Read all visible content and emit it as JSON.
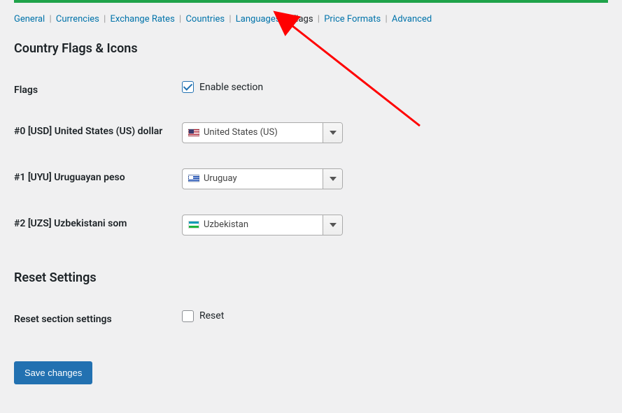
{
  "tabs": {
    "general": "General",
    "currencies": "Currencies",
    "exchange_rates": "Exchange Rates",
    "countries": "Countries",
    "languages": "Languages",
    "flags": "Flags",
    "price_formats": "Price Formats",
    "advanced": "Advanced"
  },
  "section_title": "Country Flags & Icons",
  "flags_row": {
    "label": "Flags",
    "enable_label": "Enable section",
    "checked": true
  },
  "currency_rows": [
    {
      "label": "#0 [USD] United States (US) dollar",
      "value": "United States (US)",
      "flag": "us"
    },
    {
      "label": "#1 [UYU] Uruguayan peso",
      "value": "Uruguay",
      "flag": "uy"
    },
    {
      "label": "#2 [UZS] Uzbekistani som",
      "value": "Uzbekistan",
      "flag": "uz"
    }
  ],
  "reset": {
    "title": "Reset Settings",
    "label": "Reset section settings",
    "value_label": "Reset",
    "checked": false
  },
  "save_button": "Save changes"
}
